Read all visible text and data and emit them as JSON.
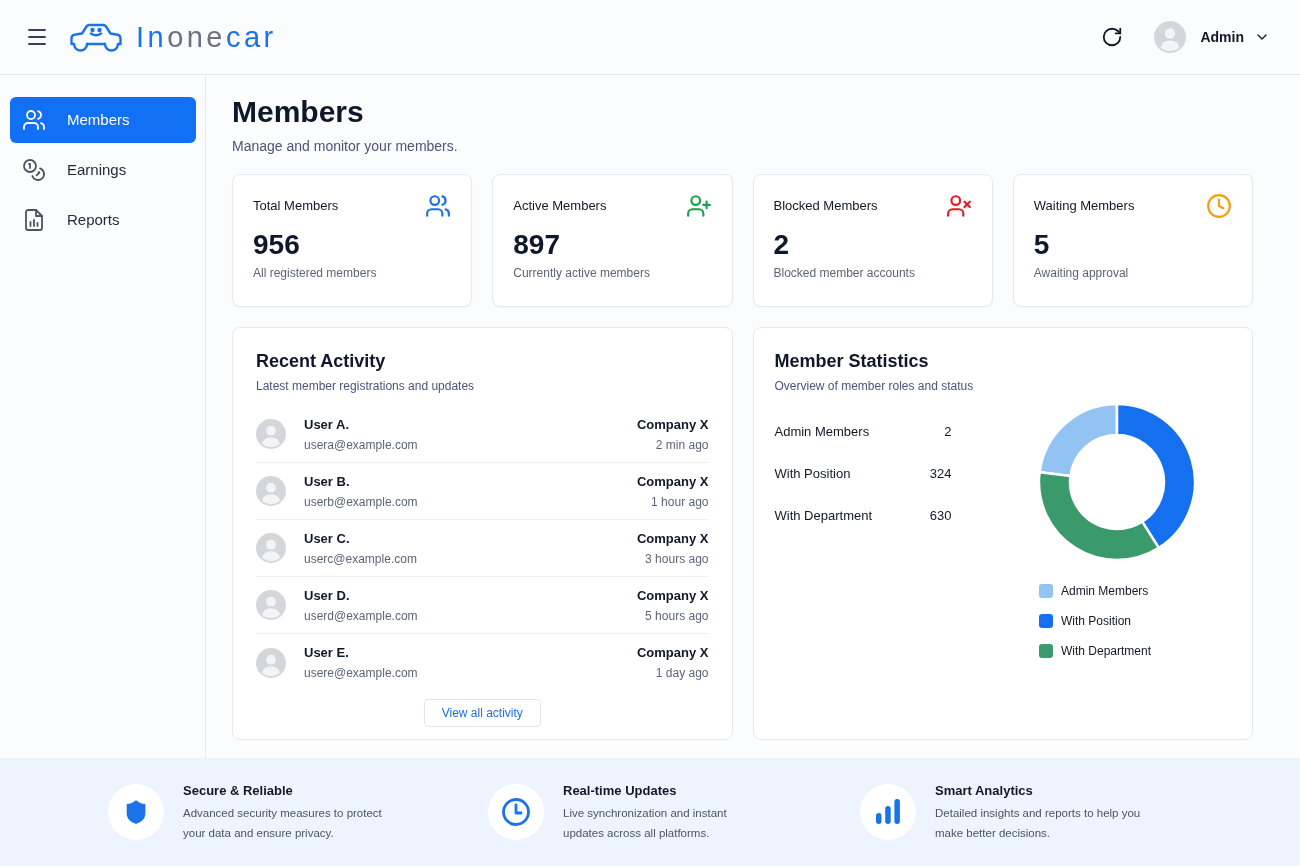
{
  "header": {
    "logo": [
      {
        "text": "In",
        "kind": "accent"
      },
      {
        "text": "one",
        "kind": "muted"
      },
      {
        "text": "car",
        "kind": "accent"
      }
    ],
    "user": {
      "name": "Admin"
    }
  },
  "sidebar": {
    "items": [
      {
        "label": "Members",
        "kind": "members",
        "selected": true
      },
      {
        "label": "Earnings",
        "kind": "earnings",
        "selected": false
      },
      {
        "label": "Reports",
        "kind": "reports",
        "selected": false
      }
    ]
  },
  "page": {
    "title": "Members",
    "subtitle": "Manage and monitor your members."
  },
  "stat_cards": [
    {
      "kind": "total",
      "title": "Total Members",
      "value": "956",
      "caption": "All registered members",
      "color": "#1a73e8"
    },
    {
      "kind": "active",
      "title": "Active Members",
      "value": "897",
      "caption": "Currently active members",
      "color": "#16a34a"
    },
    {
      "kind": "blocked",
      "title": "Blocked Members",
      "value": "2",
      "caption": "Blocked member accounts",
      "color": "#e11d2a"
    },
    {
      "kind": "waiting",
      "title": "Waiting Members",
      "value": "5",
      "caption": "Awaiting approval",
      "color": "#f59e0b"
    }
  ],
  "recent_activity": {
    "title": "Recent Activity",
    "subtitle": "Latest member registrations and updates",
    "rows": [
      {
        "name": "User A.",
        "email": "usera@example.com",
        "company": "Company X",
        "time": "2 min ago"
      },
      {
        "name": "User B.",
        "email": "userb@example.com",
        "company": "Company X",
        "time": "1 hour ago"
      },
      {
        "name": "User C.",
        "email": "userc@example.com",
        "company": "Company X",
        "time": "3 hours ago"
      },
      {
        "name": "User D.",
        "email": "userd@example.com",
        "company": "Company X",
        "time": "5 hours ago"
      },
      {
        "name": "User E.",
        "email": "usere@example.com",
        "company": "Company X",
        "time": "1 day ago"
      }
    ],
    "button": "View all activity"
  },
  "member_statistics": {
    "title": "Member Statistics",
    "subtitle": "Overview of member roles and status",
    "rows": [
      {
        "label": "Admin Members",
        "value": "2"
      },
      {
        "label": "With Position",
        "value": "324"
      },
      {
        "label": "With Department",
        "value": "630"
      }
    ],
    "chart_data": {
      "type": "donut",
      "categories": [
        "Admin Members",
        "With Position",
        "With Department"
      ],
      "values": [
        23,
        41,
        36
      ],
      "colors": [
        "#92c3f2",
        "#1570ef",
        "#3a9a6b"
      ],
      "legend": "bottom"
    }
  },
  "features": [
    {
      "kind": "security",
      "title": "Secure & Reliable",
      "description_lines": [
        "Advanced security measures to protect",
        "your data and ensure privacy."
      ]
    },
    {
      "kind": "realtime",
      "title": "Real-time Updates",
      "description_lines": [
        "Live synchronization and instant",
        "updates across all platforms."
      ]
    },
    {
      "kind": "analytics",
      "title": "Smart Analytics",
      "description_lines": [
        "Detailed insights and reports to help you",
        "make better decisions."
      ]
    }
  ]
}
